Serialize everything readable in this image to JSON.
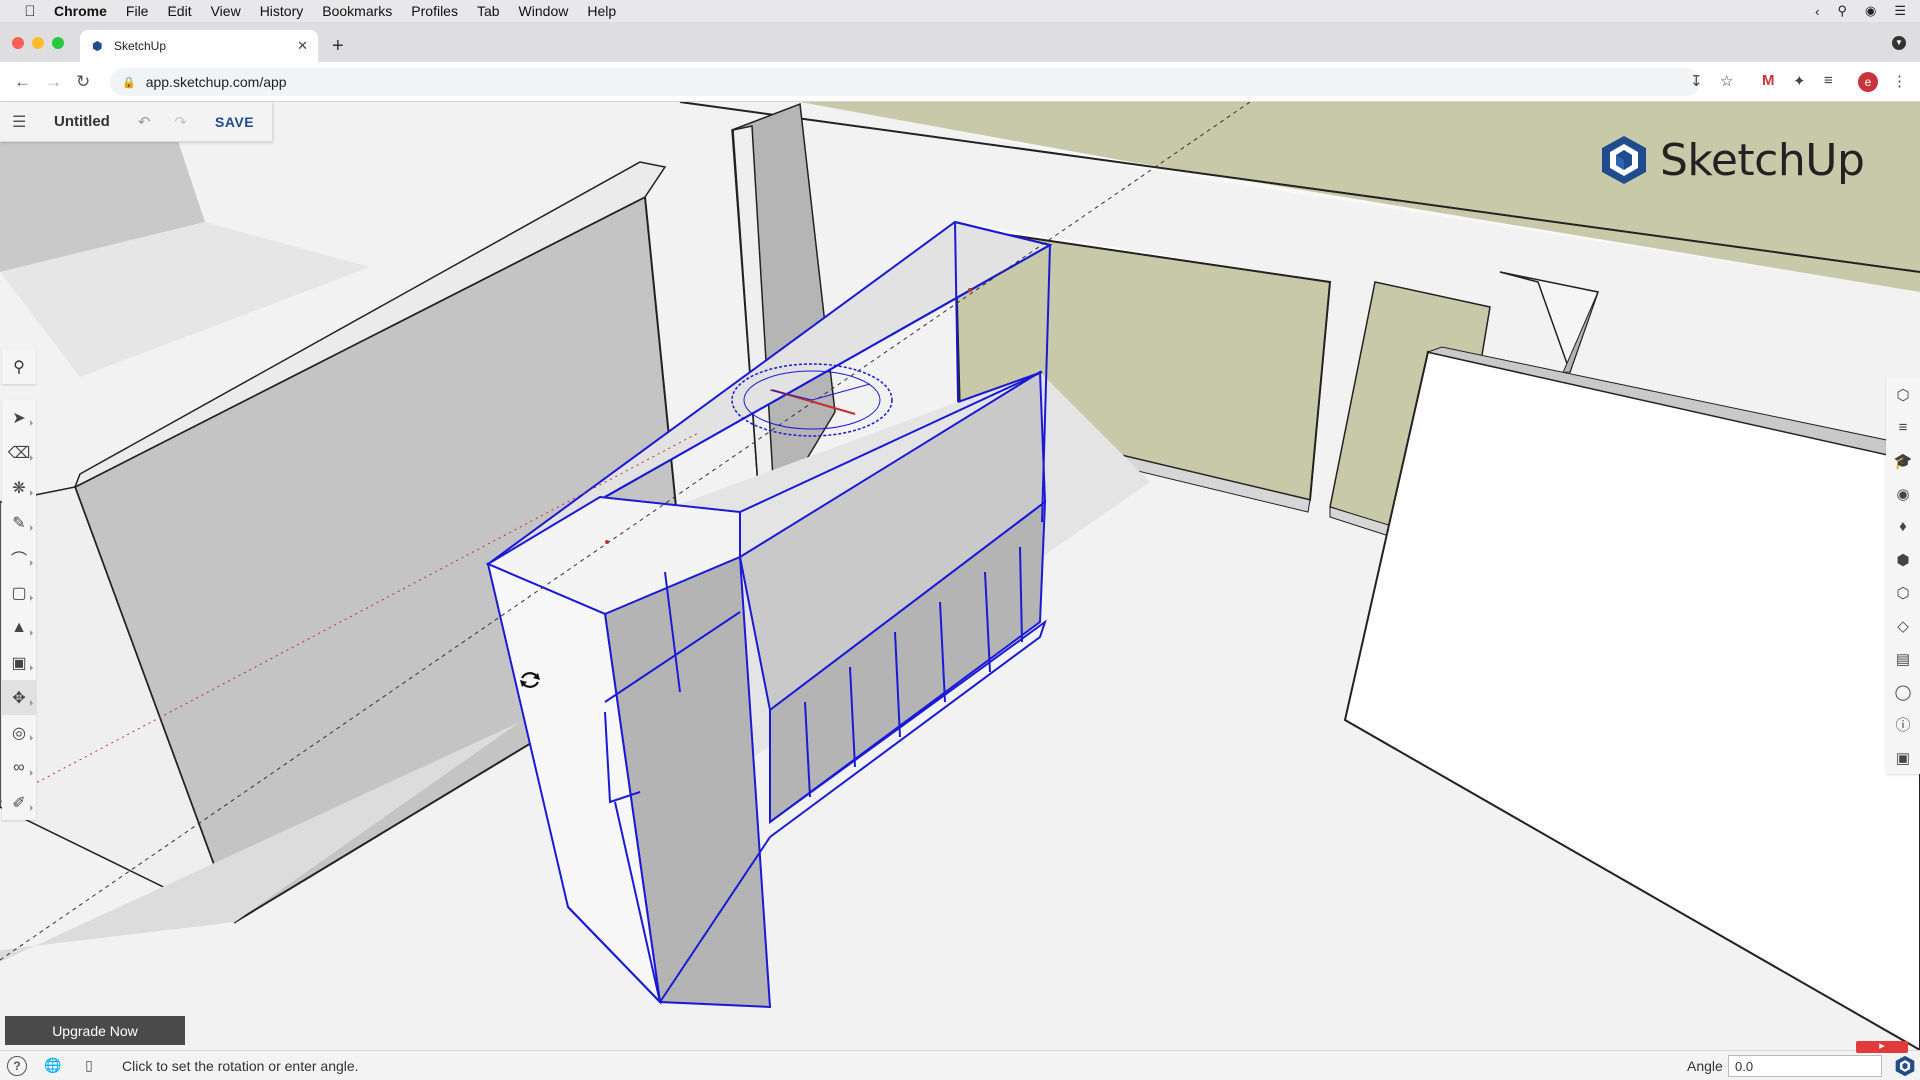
{
  "menubar": {
    "items": [
      "Chrome",
      "File",
      "Edit",
      "View",
      "History",
      "Bookmarks",
      "Profiles",
      "Tab",
      "Window",
      "Help"
    ]
  },
  "browser": {
    "tab_title": "SketchUp",
    "url": "app.sketchup.com/app"
  },
  "sketchup": {
    "doc_title": "Untitled",
    "save_label": "SAVE",
    "logo_text": "SketchUp",
    "upgrade_label": "Upgrade Now",
    "status_message": "Click to set the rotation or enter angle.",
    "measure_label": "Angle",
    "measure_value": "0.0",
    "active_tool": "move-tool"
  },
  "colors": {
    "accent": "#1e4c8c",
    "selection": "#1a1ad6",
    "wall_face": "#c9c9c9",
    "window_glass": "#c8c9a8"
  },
  "left_tools": [
    "select-tool-icon",
    "eraser-tool-icon",
    "paint-tool-icon",
    "pencil-tool-icon",
    "arc-tool-icon",
    "rectangle-tool-icon",
    "push-pull-tool-icon",
    "offset-tool-icon",
    "move-tool-icon",
    "tape-measure-tool-icon",
    "walk-tool-icon",
    "section-tool-icon"
  ],
  "right_tools": [
    "entity-info-icon",
    "layers-icon",
    "instructor-icon",
    "components-icon",
    "materials-icon",
    "styles-icon",
    "scenes-icon",
    "tags-icon",
    "animation-icon",
    "display-icon",
    "info-icon",
    "extensions-icon"
  ]
}
